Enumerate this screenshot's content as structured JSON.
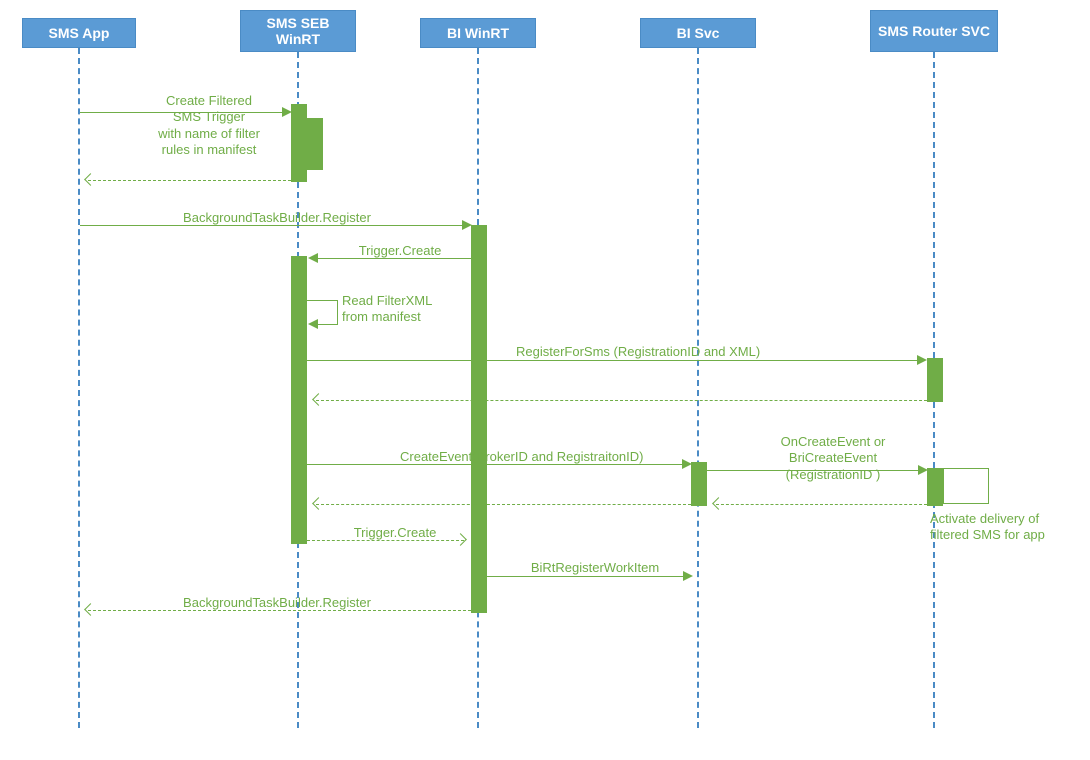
{
  "participants": {
    "p1": "SMS App",
    "p2": "SMS SEB WinRT",
    "p3": "BI WinRT",
    "p4": "BI Svc",
    "p5": "SMS Router SVC"
  },
  "messages": {
    "m1": "Create Filtered\nSMS Trigger\nwith name of filter\nrules in manifest",
    "m2": "BackgroundTaskBuilder.Register",
    "m3": "Trigger.Create",
    "m4": "Read FilterXML\nfrom manifest",
    "m5": "RegisterForSms (RegistrationID and XML)",
    "m6": "CreateEvent(BrokerID and RegistraitonID)",
    "m7": "OnCreateEvent or\nBriCreateEvent\n(RegistrationID )",
    "m8": "Trigger.Create",
    "m9": "BiRtRegisterWorkItem",
    "m10": "BackgroundTaskBuilder.Register"
  },
  "notes": {
    "n1": "Activate delivery of\nfiltered SMS for app"
  }
}
